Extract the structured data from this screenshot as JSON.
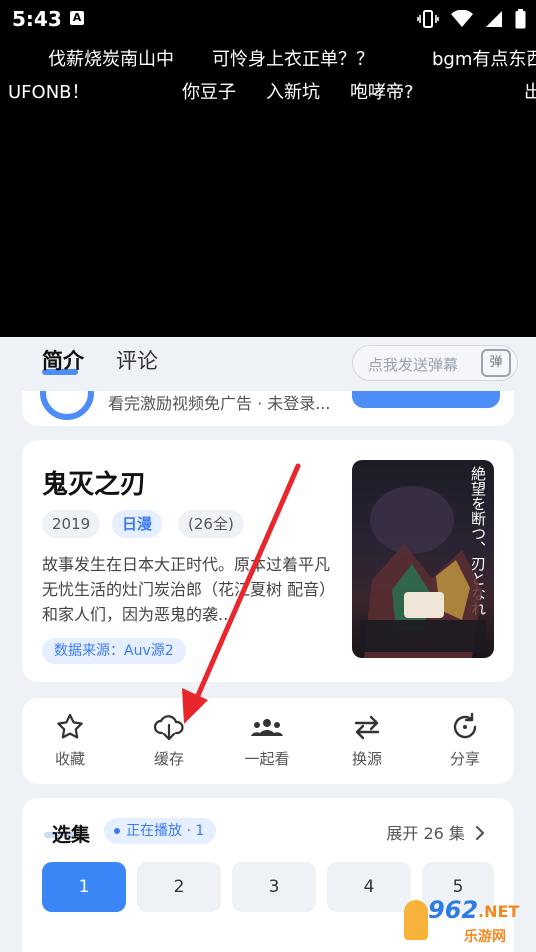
{
  "status_bar": {
    "time": "5:43",
    "notification_icon": "A"
  },
  "danmaku": [
    "伐薪烧炭南山中",
    "可怜身上衣正单？？",
    "bgm有点东西",
    "UFONB！",
    "你豆子",
    "入新坑",
    "咆哮帝?",
    "出"
  ],
  "tabs": {
    "intro": "简介",
    "comments": "评论"
  },
  "danmaku_input": {
    "placeholder": "点我发送弹幕",
    "button": "弹"
  },
  "ad_strip": {
    "text": "看完激励视频免广告 · 未登录..."
  },
  "anime": {
    "title": "鬼灭之刃",
    "year": "2019",
    "type": "日漫",
    "episodes_count": "(26全)",
    "description": "故事发生在日本大正时代。原本过着平凡无忧生活的灶门炭治郎（花江夏树 配音）和家人们，因为恶鬼的袭...",
    "source": "数据来源：Auv源2",
    "poster_text": "絶望を断つ、刃となれ"
  },
  "actions": [
    {
      "label": "收藏",
      "icon": "star-icon"
    },
    {
      "label": "缓存",
      "icon": "download-cloud-icon"
    },
    {
      "label": "一起看",
      "icon": "group-icon"
    },
    {
      "label": "换源",
      "icon": "swap-icon"
    },
    {
      "label": "分享",
      "icon": "share-icon"
    }
  ],
  "episode_section": {
    "title": "选集",
    "now_playing": "正在播放 · 1",
    "expand": "展开 26 集",
    "episodes": [
      "1",
      "2",
      "3",
      "4",
      "5"
    ],
    "current": "1"
  },
  "watermark": {
    "number": "962",
    "suffix": ".NET",
    "name": "乐游网"
  },
  "colors": {
    "accent": "#3a86f7",
    "annotation_arrow": "#e8262b"
  }
}
